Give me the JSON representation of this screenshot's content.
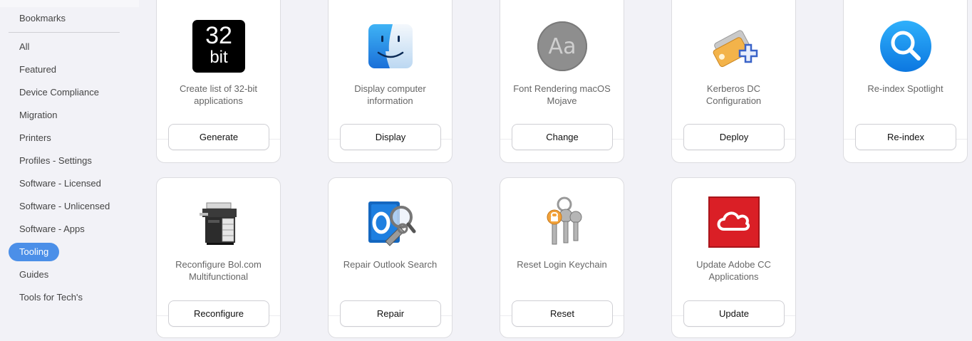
{
  "sidebar": {
    "bookmarks_label": "Bookmarks",
    "items": [
      {
        "label": "All"
      },
      {
        "label": "Featured"
      },
      {
        "label": "Device Compliance"
      },
      {
        "label": "Migration"
      },
      {
        "label": "Printers"
      },
      {
        "label": "Profiles - Settings"
      },
      {
        "label": "Software - Licensed"
      },
      {
        "label": "Software - Unlicensed"
      },
      {
        "label": "Software - Apps"
      },
      {
        "label": "Tooling",
        "active": true
      },
      {
        "label": "Guides"
      },
      {
        "label": "Tools for Tech's"
      }
    ]
  },
  "cards": [
    {
      "title": "Create list of 32-bit applications",
      "button": "Generate",
      "icon": "32bit-icon",
      "icon_text_top": "32",
      "icon_text_bottom": "bit"
    },
    {
      "title": "Display computer information",
      "button": "Display",
      "icon": "finder-icon"
    },
    {
      "title": "Font Rendering macOS Mojave",
      "button": "Change",
      "icon": "font-book-icon",
      "icon_text": "Aa"
    },
    {
      "title": "Kerberos DC Configuration",
      "button": "Deploy",
      "icon": "kerberos-tickets-icon"
    },
    {
      "title": "Re-index Spotlight",
      "button": "Re-index",
      "icon": "spotlight-icon"
    },
    {
      "title": "Reconfigure Bol.com Multifunctional",
      "button": "Reconfigure",
      "icon": "printer-icon"
    },
    {
      "title": "Repair Outlook Search",
      "button": "Repair",
      "icon": "outlook-repair-icon"
    },
    {
      "title": "Reset Login Keychain",
      "button": "Reset",
      "icon": "keychain-icon"
    },
    {
      "title": "Update Adobe CC Applications",
      "button": "Update",
      "icon": "adobe-cc-icon"
    }
  ],
  "colors": {
    "accent": "#4b8fe8",
    "background": "#f2f2f7"
  }
}
